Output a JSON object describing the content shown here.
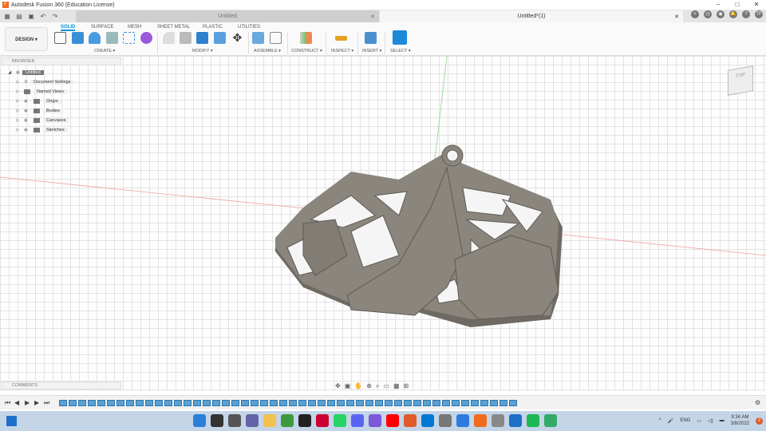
{
  "app": {
    "title": "Autodesk Fusion 360 (Education License)"
  },
  "tabs": [
    {
      "label": "Untitled"
    },
    {
      "label": "Untitled*(1)"
    }
  ],
  "workspace": {
    "label": "DESIGN ▾"
  },
  "ribbon_tabs": [
    "SOLID",
    "SURFACE",
    "MESH",
    "SHEET METAL",
    "PLASTIC",
    "UTILITIES"
  ],
  "groups": [
    "CREATE ▾",
    "MODIFY ▾",
    "ASSEMBLE ▾",
    "CONSTRUCT ▾",
    "INSPECT ▾",
    "INSERT ▾",
    "SELECT ▾"
  ],
  "browser": {
    "title": "BROWSER",
    "root": "Untitled",
    "items": [
      "Document Settings",
      "Named Views",
      "Origin",
      "Bodies",
      "Canvases",
      "Sketches"
    ]
  },
  "comments": {
    "title": "COMMENTS"
  },
  "viewcube": {
    "face": "TOP"
  },
  "tray": {
    "lang": "ENG",
    "time": "9:34 AM",
    "date": "3/8/2022",
    "badge": "2"
  }
}
